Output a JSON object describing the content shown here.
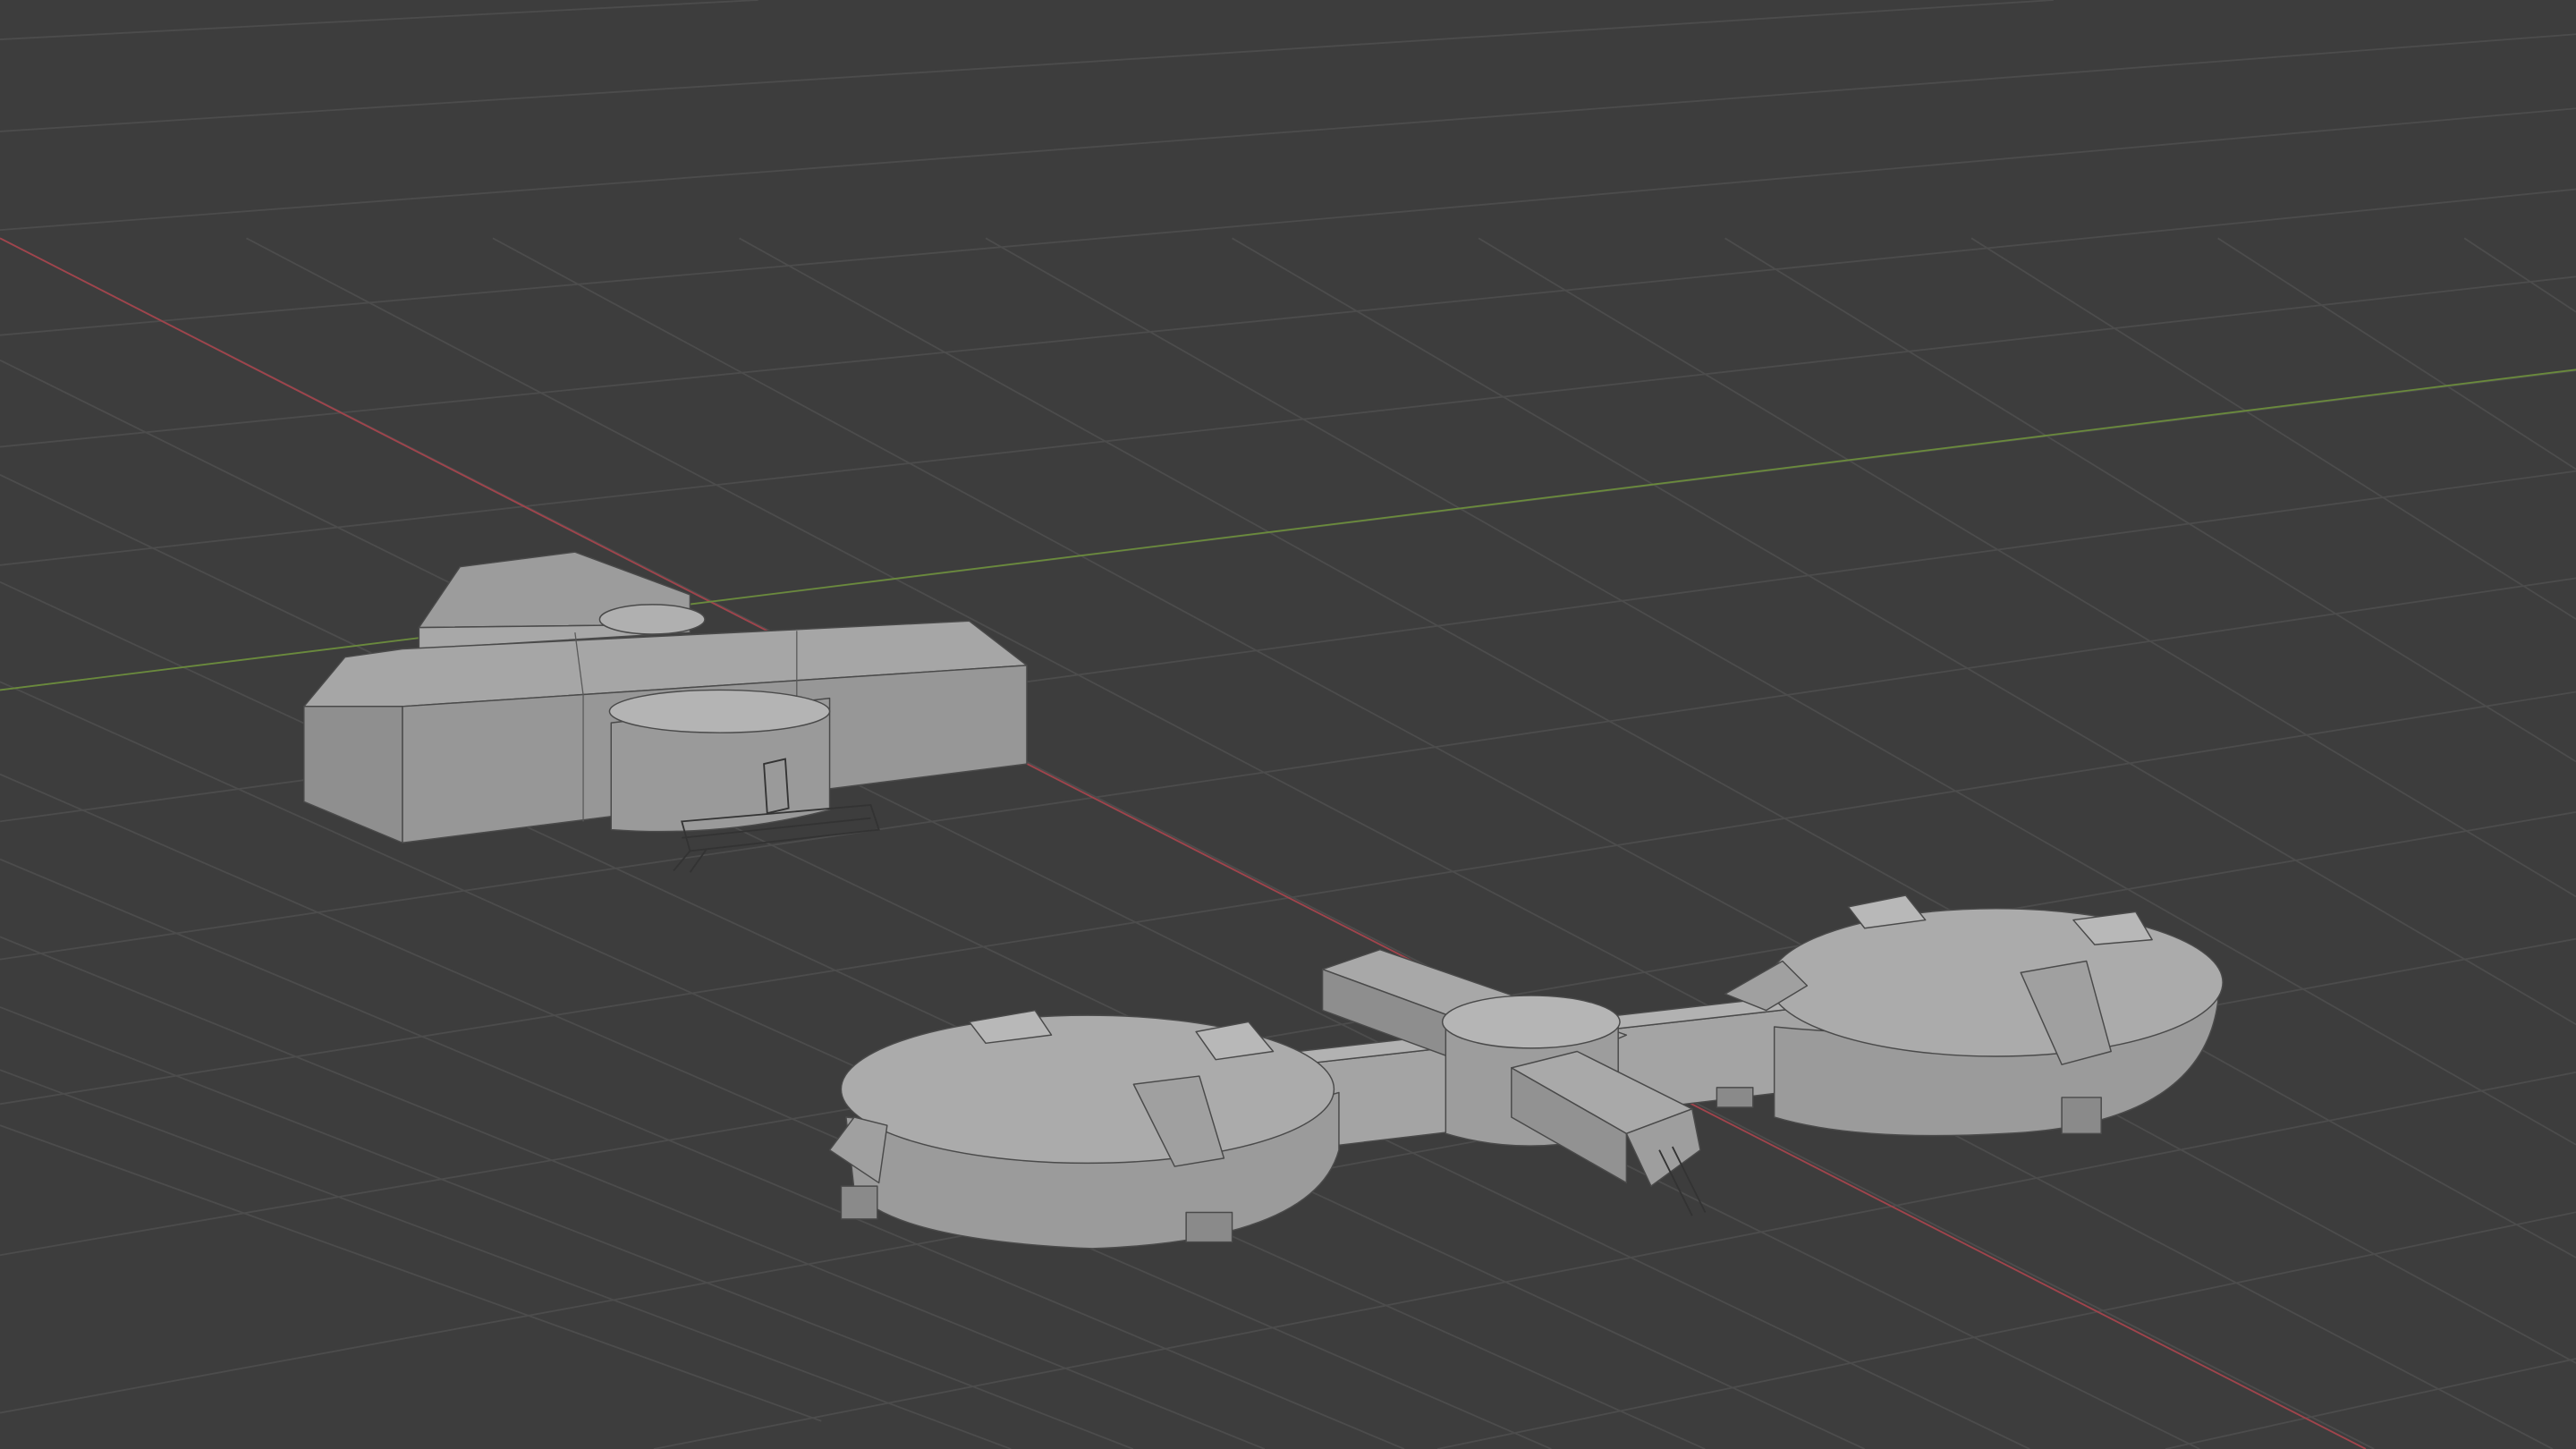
{
  "viewport": {
    "background": "#3d3d3d",
    "grid_color": "#4c4c4c",
    "x_axis_color": "#a0444c",
    "y_axis_color": "#6a8a3c",
    "mesh_color": "#a2a2a2"
  }
}
